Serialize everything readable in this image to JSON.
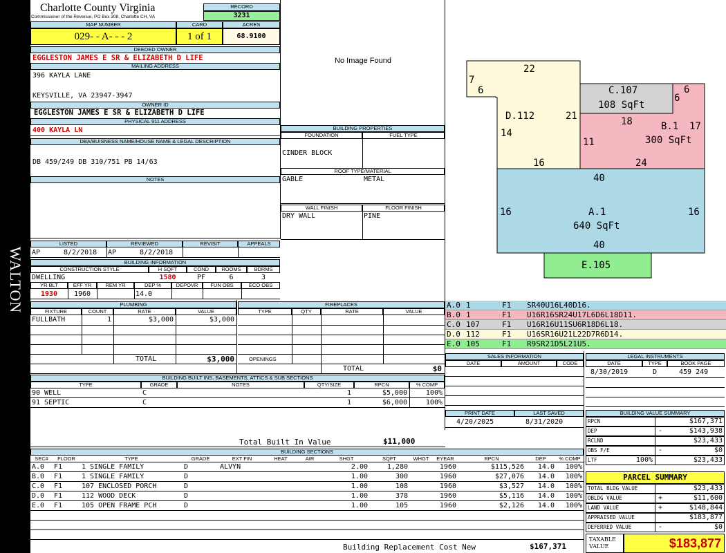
{
  "side_label": "WALTON",
  "header": {
    "county": "Charlotte County Virginia",
    "subtitle": "Commissioner of the Revenue, PO Box 308, Charlotte CH, VA",
    "record_label": "RECORD",
    "record": "3231",
    "map_label": "MAP NUMBER",
    "map_number": "029- - A- - - 2",
    "card_label": "CARD",
    "card": "1 of 1",
    "acres_label": "ACRES",
    "acres": "68.9100"
  },
  "owner": {
    "deeded_label": "DEEDED OWNER",
    "deeded": "EGGLESTON JAMES E SR & ELIZABETH D LIFE",
    "mailing_label": "MAILING ADDRESS",
    "mail1": "396 KAYLA LANE",
    "mail2": "KEYSVILLE, VA 23947-3947",
    "owner_id_label": "OWNER ID",
    "owner_id": "EGGLESTON JAMES E SR & ELIZABETH D LIFE",
    "phys_label": "PHYSICAL 911 ADDRESS",
    "phys": "400 KAYLA LN",
    "dba_label": "DBA/BUISNESS NAME/HOUSE NAME & LEGAL DESCRIPTION",
    "legal": "DB 459/249 DB 310/751 PB 14/63",
    "notes_label": "NOTES"
  },
  "image_text": "No Image Found",
  "bldg_props": {
    "title": "BUILDING PROPERTIES",
    "foundation_label": "FOUNDATION",
    "fuel_label": "FUEL TYPE",
    "foundation": "CINDER BLOCK",
    "roof_label": "ROOF TYPE/MATERIAL",
    "roof_type": "GABLE",
    "roof_mat": "METAL",
    "wall_label": "WALL FINISH",
    "floor_label": "FLOOR FINISH",
    "wall": "DRY WALL",
    "floor": "PINE"
  },
  "dates": {
    "listed_label": "LISTED",
    "reviewed_label": "REVIEWED",
    "revisit_label": "REVISIT",
    "appeals_label": "APPEALS",
    "l_by": "AP",
    "l_date": "8/2/2018",
    "r_by": "AP",
    "r_date": "8/2/2018"
  },
  "bldg_info": {
    "title": "BUILDING INFORMATION",
    "h_style": "CONSTRUCTION STYLE",
    "h_sqft": "H SQFT",
    "h_cond": "COND",
    "h_rooms": "ROOMS",
    "h_bdrms": "BDRMS",
    "style": "DWELLING",
    "sqft": "1580",
    "cond": "PF",
    "rooms": "6",
    "bdrms": "3",
    "h_yrblt": "YR BLT",
    "h_effyr": "EFF YR",
    "h_remyr": "REM YR",
    "h_dep": "DEP %",
    "h_depovr": "DEPOVR",
    "h_funobs": "FUN OBS",
    "h_ecoobs": "ECO OBS",
    "yrblt": "1930",
    "effyr": "1960",
    "dep": "14.0"
  },
  "plumbing": {
    "title": "PLUMBING",
    "h_fixture": "FIXTURE",
    "h_count": "COUNT",
    "h_rate": "RATE",
    "h_value": "VALUE",
    "fixture": "FULLBATH",
    "count": "1",
    "rate": "$3,000",
    "value": "$3,000",
    "total_label": "TOTAL",
    "total": "$3,000"
  },
  "fireplaces": {
    "title": "FIREPLACES",
    "h_type": "TYPE",
    "h_qty": "QTY",
    "h_rate": "RATE",
    "h_value": "VALUE",
    "openings_label": "OPENINGS",
    "total_label": "TOTAL",
    "total": "$0"
  },
  "builtins": {
    "title": "BUILDING BUILT INS, BASEMENTS, ATTICS & SUB SECTIONS",
    "h_type": "TYPE",
    "h_grade": "GRADE",
    "h_notes": "NOTES",
    "h_qty": "QTY/SIZE",
    "h_rpcn": "RPCN",
    "h_comp": "% COMP",
    "rows": [
      {
        "type": "90 WELL",
        "grade": "C",
        "qty": "1",
        "rpcn": "$5,000",
        "comp": "100%"
      },
      {
        "type": "91 SEPTIC",
        "grade": "C",
        "qty": "1",
        "rpcn": "$6,000",
        "comp": "100%"
      }
    ],
    "total_label": "Total Built In Value",
    "total": "$11,000"
  },
  "sections": {
    "title": "BUILDING SECTIONS",
    "headers": [
      "SEC#",
      "FLOOR",
      "TYPE",
      "GRADE",
      "EXT FIN",
      "HEAT",
      "AIR",
      "SHGT",
      "SQFT",
      "WHGT",
      "EYEAR",
      "RPCN",
      "DEP",
      "% COMP"
    ],
    "rows": [
      [
        "A.0",
        "F1",
        "1 SINGLE FAMILY",
        "D",
        "ALVYN",
        "",
        "",
        "2.00",
        "1,280",
        "",
        "1960",
        "$115,526",
        "14.0",
        "100%"
      ],
      [
        "B.0",
        "F1",
        "1 SINGLE FAMILY",
        "D",
        "",
        "",
        "",
        "1.00",
        "300",
        "",
        "1960",
        "$27,076",
        "14.0",
        "100%"
      ],
      [
        "C.0",
        "F1",
        "107 ENCLOSED PORCH",
        "D",
        "",
        "",
        "",
        "1.00",
        "108",
        "",
        "1960",
        "$3,527",
        "14.0",
        "100%"
      ],
      [
        "D.0",
        "F1",
        "112 WOOD DECK",
        "D",
        "",
        "",
        "",
        "1.00",
        "378",
        "",
        "1960",
        "$5,116",
        "14.0",
        "100%"
      ],
      [
        "E.0",
        "F1",
        "105 OPEN FRAME PCH",
        "D",
        "",
        "",
        "",
        "1.00",
        "105",
        "",
        "1960",
        "$2,126",
        "14.0",
        "100%"
      ]
    ],
    "brcn_label": "Building Replacement Cost New",
    "brcn": "$167,371"
  },
  "sketch": {
    "labels": {
      "a": "A.1",
      "a_sqft": "640 SqFt",
      "b": "B.1",
      "b_sqft": "300 SqFt",
      "c": "C.107",
      "c_sqft": "108 SqFt",
      "d": "D.112",
      "e": "E.105"
    },
    "dims": {
      "d_top": "22",
      "d_7": "7",
      "d_6": "6",
      "d_21": "21",
      "d_14": "14",
      "d_16": "16",
      "c_6a": "6",
      "c_6b": "6",
      "b_18": "18",
      "b_17": "17",
      "b_11": "11",
      "b_24": "24",
      "a_40top": "40",
      "a_16l": "16",
      "a_16r": "16",
      "a_40bot": "40"
    },
    "colors": {
      "a": "#add8e6",
      "b": "#f5b7c0",
      "c": "#d3d3d3",
      "d": "#fffadc",
      "e": "#90ee90"
    }
  },
  "legend": [
    {
      "sec": "A.0",
      "n": "1",
      "f": "F1",
      "path": "SR40U16L40D16.",
      "color": "#add8e6"
    },
    {
      "sec": "B.0",
      "n": "1",
      "f": "F1",
      "path": "U16R16SR24U17L6D6L18D11.",
      "color": "#f5b7c0"
    },
    {
      "sec": "C.0",
      "n": "107",
      "f": "F1",
      "path": "U16R16U11SU6R18D6L18.",
      "color": "#d3d3d3"
    },
    {
      "sec": "D.0",
      "n": "112",
      "f": "F1",
      "path": "U16SR16U21L22D7R6D14.",
      "color": "#fffadc"
    },
    {
      "sec": "E.0",
      "n": "105",
      "f": "F1",
      "path": "R9SR21D5L21U5.",
      "color": "#90ee90"
    }
  ],
  "sales": {
    "title": "SALES INFORMATION",
    "h_date": "DATE",
    "h_amount": "AMOUNT",
    "h_code": "CODE"
  },
  "legal_instr": {
    "title": "LEGAL INSTRUMENTS",
    "h_date": "DATE",
    "h_type": "TYPE",
    "h_book": "BOOK PAGE",
    "date": "8/30/2019",
    "type": "D",
    "book": "459 249"
  },
  "print": {
    "print_label": "PRINT DATE",
    "saved_label": "LAST SAVED",
    "print_date": "4/20/2025",
    "saved_date": "8/31/2020"
  },
  "bvs": {
    "title": "BUILDING VALUE SUMMARY",
    "rows": [
      {
        "label": "RPCN",
        "sign": "",
        "value": "$167,371"
      },
      {
        "label": "DEP",
        "sign": "-",
        "value": "$143,938"
      },
      {
        "label": "RCLND",
        "sign": "",
        "value": "$23,433"
      },
      {
        "label": "OBS F/E",
        "sign": "-",
        "value": "$0"
      },
      {
        "label": "LTF",
        "pct": "100%",
        "sign": "",
        "value": "$23,433"
      }
    ]
  },
  "parcel": {
    "title": "PARCEL SUMMARY",
    "rows": [
      {
        "label": "TOTAL BLDG VALUE",
        "sign": "",
        "value": "$23,433"
      },
      {
        "label": "OBLDG VALUE",
        "sign": "+",
        "value": "$11,600"
      },
      {
        "label": "LAND VALUE",
        "sign": "+",
        "value": "$148,844"
      },
      {
        "label": "APPRAISED VALUE",
        "sign": "",
        "value": "$183,877"
      },
      {
        "label": "DEFERRED VALUE",
        "sign": "-",
        "value": "$0"
      }
    ],
    "taxable_label1": "TAXABLE",
    "taxable_label2": "VALUE",
    "taxable": "$183,877"
  }
}
